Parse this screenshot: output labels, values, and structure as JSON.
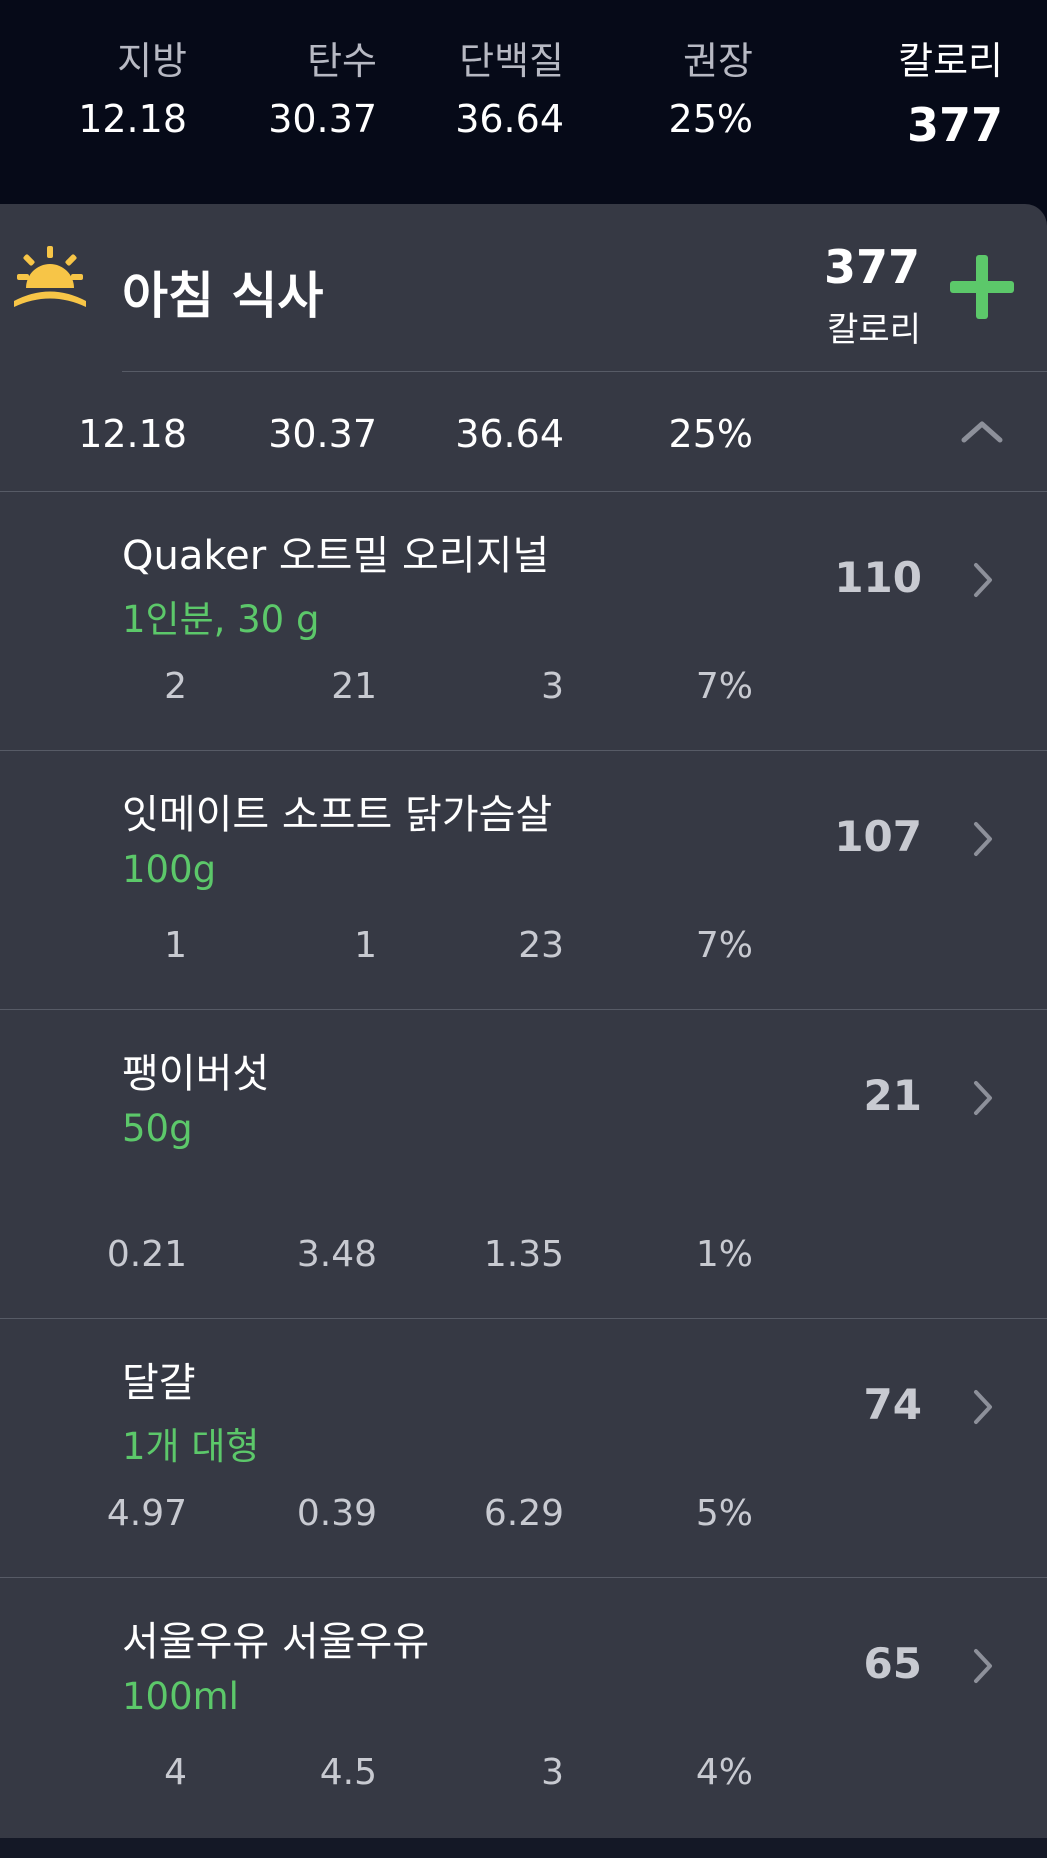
{
  "summary": {
    "headers": {
      "fat": "지방",
      "carbs": "탄수",
      "protein": "단백질",
      "rdi": "권장",
      "calories": "칼로리"
    },
    "values": {
      "fat": "12.18",
      "carbs": "30.37",
      "protein": "36.64",
      "rdi": "25%",
      "calories": "377"
    }
  },
  "meal": {
    "title": "아침 식사",
    "icon": "sunrise-icon",
    "calories": "377",
    "calories_label": "칼로리",
    "totals": {
      "fat": "12.18",
      "carbs": "30.37",
      "protein": "36.64",
      "rdi": "25%"
    }
  },
  "foods": [
    {
      "name": "Quaker 오트밀 오리지널",
      "amount": "1인분, 30 g",
      "calories": "110",
      "fat": "2",
      "carbs": "21",
      "protein": "3",
      "rdi": "7%"
    },
    {
      "name": "잇메이트 소프트 닭가슴살",
      "amount": "100g",
      "calories": "107",
      "fat": "1",
      "carbs": "1",
      "protein": "23",
      "rdi": "7%"
    },
    {
      "name": "팽이버섯",
      "amount": "50g",
      "calories": "21",
      "fat": "0.21",
      "carbs": "3.48",
      "protein": "1.35",
      "rdi": "1%"
    },
    {
      "name": "달걀",
      "amount": "1개 대형",
      "calories": "74",
      "fat": "4.97",
      "carbs": "0.39",
      "protein": "6.29",
      "rdi": "5%"
    },
    {
      "name": "서울우유 서울우유",
      "amount": "100ml",
      "calories": "65",
      "fat": "4",
      "carbs": "4.5",
      "protein": "3",
      "rdi": "4%"
    }
  ],
  "colors": {
    "background": "#060a18",
    "card": "#363944",
    "accent_green": "#5cc86a",
    "sun_yellow": "#f7c547",
    "divider": "#575b66"
  }
}
